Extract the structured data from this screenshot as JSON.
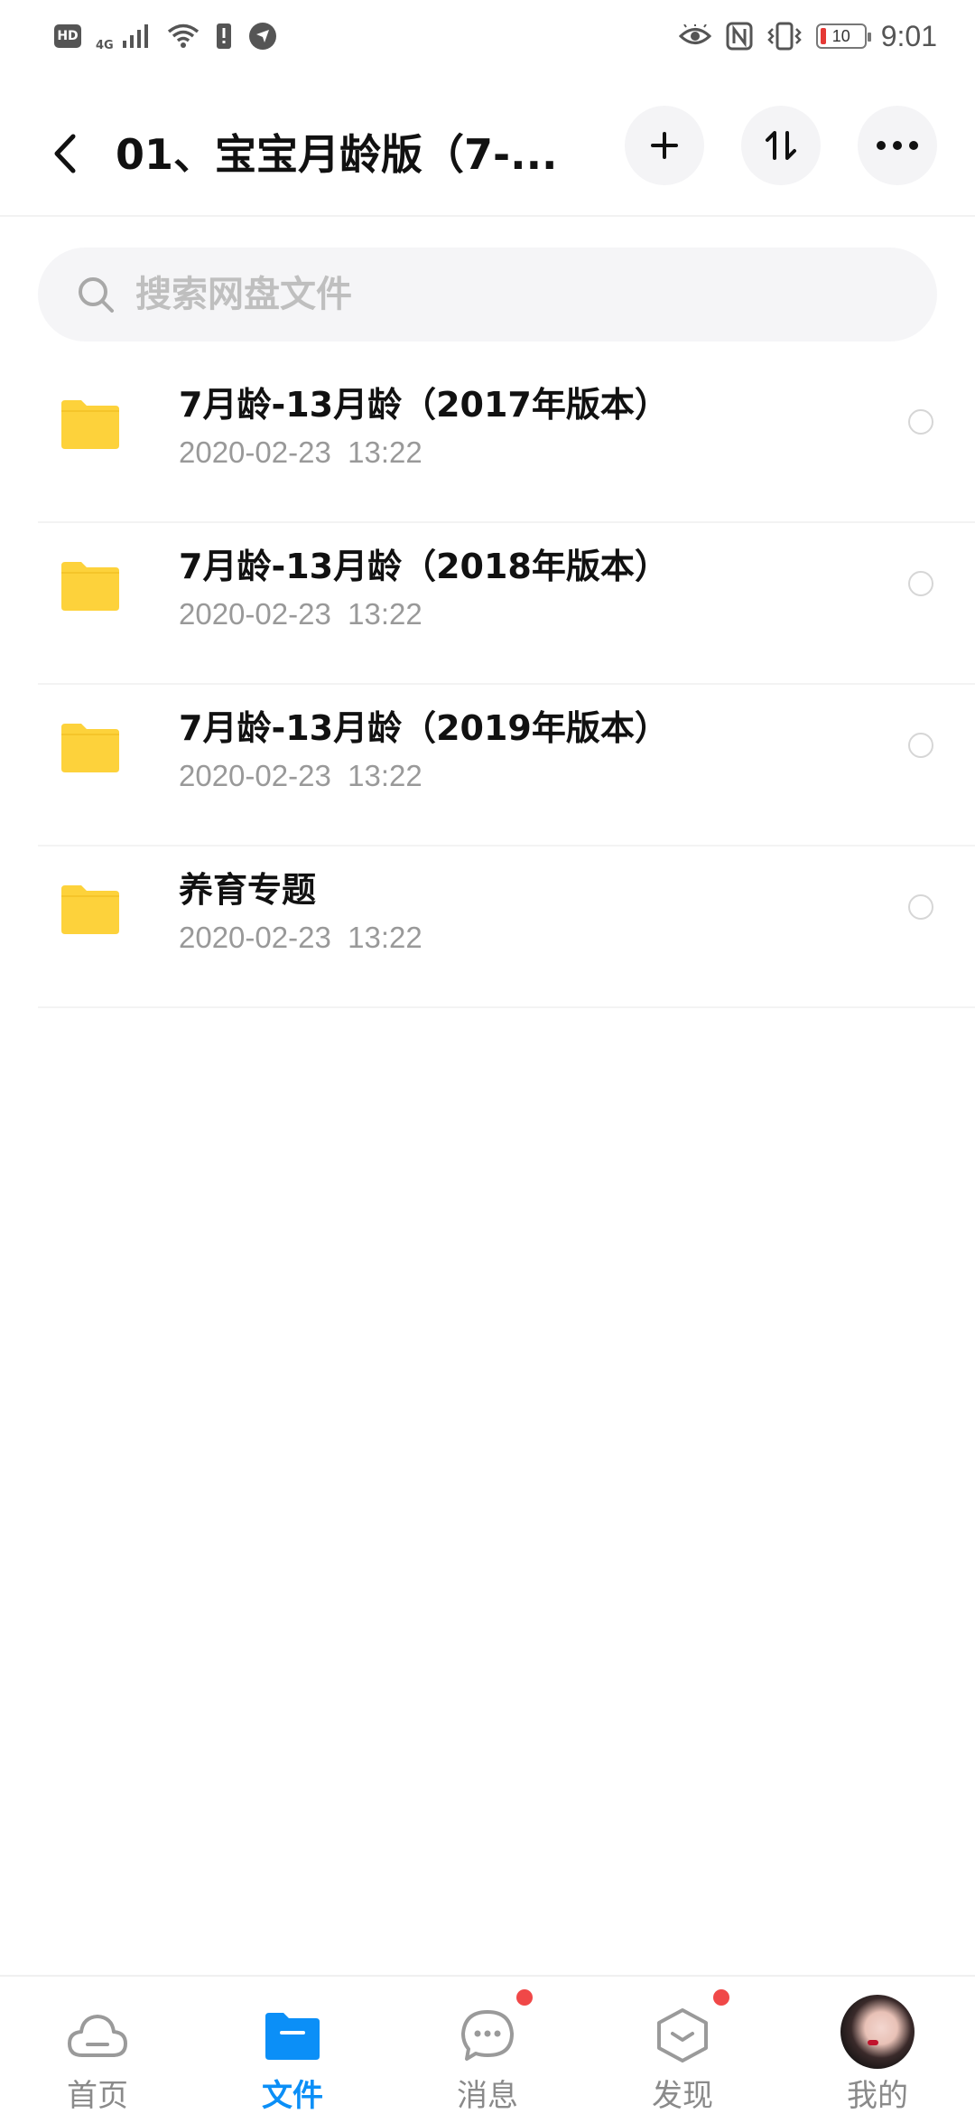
{
  "status_bar": {
    "left_icons": [
      "hd-icon",
      "signal-4g-icon",
      "wifi-icon",
      "alert-icon",
      "location-icon"
    ],
    "hd_label": "HD",
    "network_label": "4G",
    "battery_level": "10",
    "time": "9:01",
    "right_icons": [
      "eye-icon",
      "nfc-icon",
      "vibrate-icon",
      "battery-icon"
    ]
  },
  "header": {
    "title": "01、宝宝月龄版（7-...",
    "buttons": [
      "add-icon",
      "sort-icon",
      "more-icon"
    ]
  },
  "search": {
    "placeholder": "搜索网盘文件"
  },
  "files": [
    {
      "name": "7月龄-13月龄（2017年版本）",
      "date": "2020-02-23  13:22"
    },
    {
      "name": "7月龄-13月龄（2018年版本）",
      "date": "2020-02-23  13:22"
    },
    {
      "name": "7月龄-13月龄（2019年版本）",
      "date": "2020-02-23  13:22"
    },
    {
      "name": "养育专题",
      "date": "2020-02-23  13:22"
    }
  ],
  "bottom_nav": {
    "items": [
      {
        "label": "首页",
        "icon": "cloud-icon",
        "active": false
      },
      {
        "label": "文件",
        "icon": "folder-icon",
        "active": true
      },
      {
        "label": "消息",
        "icon": "message-icon",
        "active": false,
        "badge": true
      },
      {
        "label": "发现",
        "icon": "discover-icon",
        "active": false,
        "badge": true
      },
      {
        "label": "我的",
        "icon": "avatar",
        "active": false
      }
    ]
  },
  "colors": {
    "accent": "#0b8ff7",
    "folder": "#fdd23b",
    "badge": "#f04848",
    "muted_text": "#999999"
  }
}
